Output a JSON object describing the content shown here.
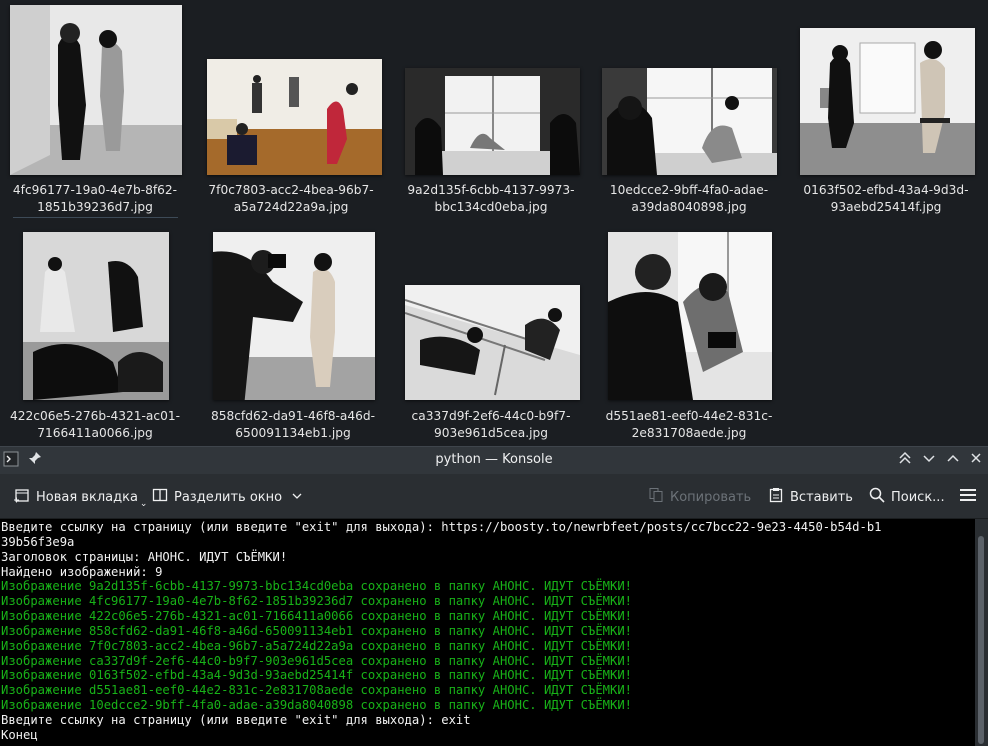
{
  "file_manager": {
    "files": [
      {
        "line1": "4fc96177-19a0-4e7b-8f62-",
        "line2": "1851b39236d7.jpg",
        "icon": "image-thumbnail-photographer-and-model"
      },
      {
        "line1": "7f0c7803-acc2-4bea-96b7-",
        "line2": "a5a724d22a9a.jpg",
        "icon": "image-thumbnail-color-studio-shoot"
      },
      {
        "line1": "9a2d135f-6cbb-4137-9973-",
        "line2": "bbc134cd0eba.jpg",
        "icon": "image-thumbnail-window-shoot"
      },
      {
        "line1": "10edcce2-9bff-4fa0-adae-",
        "line2": "a39da8040898.jpg",
        "icon": "image-thumbnail-window-shoot"
      },
      {
        "line1": "0163f502-efbd-43a4-9d3d-",
        "line2": "93aebd25414f.jpg",
        "icon": "image-thumbnail-model-on-stool"
      },
      {
        "line1": "422c06e5-276b-4321-ac01-",
        "line2": "7166411a0066.jpg",
        "icon": "image-thumbnail-photographers-on-floor"
      },
      {
        "line1": "858cfd62-da91-46f8-a46d-",
        "line2": "650091134eb1.jpg",
        "icon": "image-thumbnail-photographer-and-model"
      },
      {
        "line1": "ca337d9f-2ef6-44c0-b9f7-",
        "line2": "903e961d5cea.jpg",
        "icon": "image-thumbnail-ballet-barre-shoot"
      },
      {
        "line1": "d551ae81-eef0-44e2-831c-",
        "line2": "2e831708aede.jpg",
        "icon": "image-thumbnail-camera-review"
      }
    ]
  },
  "konsole": {
    "title": "python — Konsole",
    "toolbar": {
      "new_tab": "Новая вкладка",
      "split": "Разделить окно",
      "copy": "Копировать",
      "paste": "Вставить",
      "find": "Поиск..."
    },
    "lines": [
      {
        "text": "Введите ссылку на страницу (или введите \"exit\" для выхода): https://boosty.to/newrbfeet/posts/cc7bcc22-9e23-4450-b54d-b1",
        "green": false
      },
      {
        "text": "39b56f3e9a",
        "green": false
      },
      {
        "text": "Заголовок страницы: АНОНС. ИДУТ СЪЁМКИ!",
        "green": false
      },
      {
        "text": "Найдено изображений: 9",
        "green": false
      },
      {
        "text": "Изображение 9a2d135f-6cbb-4137-9973-bbc134cd0eba сохранено в папку АНОНС. ИДУТ СЪЁМКИ!",
        "green": true
      },
      {
        "text": "Изображение 4fc96177-19a0-4e7b-8f62-1851b39236d7 сохранено в папку АНОНС. ИДУТ СЪЁМКИ!",
        "green": true
      },
      {
        "text": "Изображение 422c06e5-276b-4321-ac01-7166411a0066 сохранено в папку АНОНС. ИДУТ СЪЁМКИ!",
        "green": true
      },
      {
        "text": "Изображение 858cfd62-da91-46f8-a46d-650091134eb1 сохранено в папку АНОНС. ИДУТ СЪЁМКИ!",
        "green": true
      },
      {
        "text": "Изображение 7f0c7803-acc2-4bea-96b7-a5a724d22a9a сохранено в папку АНОНС. ИДУТ СЪЁМКИ!",
        "green": true
      },
      {
        "text": "Изображение ca337d9f-2ef6-44c0-b9f7-903e961d5cea сохранено в папку АНОНС. ИДУТ СЪЁМКИ!",
        "green": true
      },
      {
        "text": "Изображение 0163f502-efbd-43a4-9d3d-93aebd25414f сохранено в папку АНОНС. ИДУТ СЪЁМКИ!",
        "green": true
      },
      {
        "text": "Изображение d551ae81-eef0-44e2-831c-2e831708aede сохранено в папку АНОНС. ИДУТ СЪЁМКИ!",
        "green": true
      },
      {
        "text": "Изображение 10edcce2-9bff-4fa0-adae-a39da8040898 сохранено в папку АНОНС. ИДУТ СЪЁМКИ!",
        "green": true
      },
      {
        "text": "Введите ссылку на страницу (или введите \"exit\" для выхода): exit",
        "green": false
      },
      {
        "text": "Конец",
        "green": false
      }
    ]
  },
  "colors": {
    "terminal_ok": "#18b218",
    "terminal_fg": "#f2f2f2",
    "terminal_bg": "#000000"
  }
}
